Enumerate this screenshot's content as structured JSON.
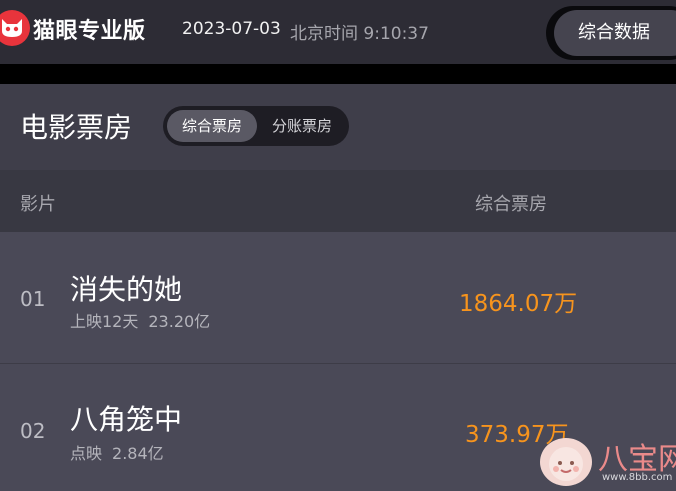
{
  "header": {
    "brand": "猫眼专业版",
    "date": "2023-07-03",
    "time": "北京时间 9:10:37",
    "data_button": "综合数据"
  },
  "section": {
    "title": "电影票房",
    "tabs": [
      {
        "label": "综合票房",
        "active": true
      },
      {
        "label": "分账票房",
        "active": false
      }
    ]
  },
  "table": {
    "columns": [
      "影片",
      "综合票房"
    ],
    "rows": [
      {
        "rank": "01",
        "name": "消失的她",
        "status": "上映12天",
        "total": "23.20亿",
        "gross": "1864.07万"
      },
      {
        "rank": "02",
        "name": "八角笼中",
        "status": "点映",
        "total": "2.84亿",
        "gross": "373.97万"
      }
    ]
  },
  "watermark": {
    "text": "八宝网",
    "url": "www.8bb.com"
  },
  "colors": {
    "accent_orange": "#f7941d",
    "brand_red": "#e8343c",
    "background": "#454452"
  }
}
